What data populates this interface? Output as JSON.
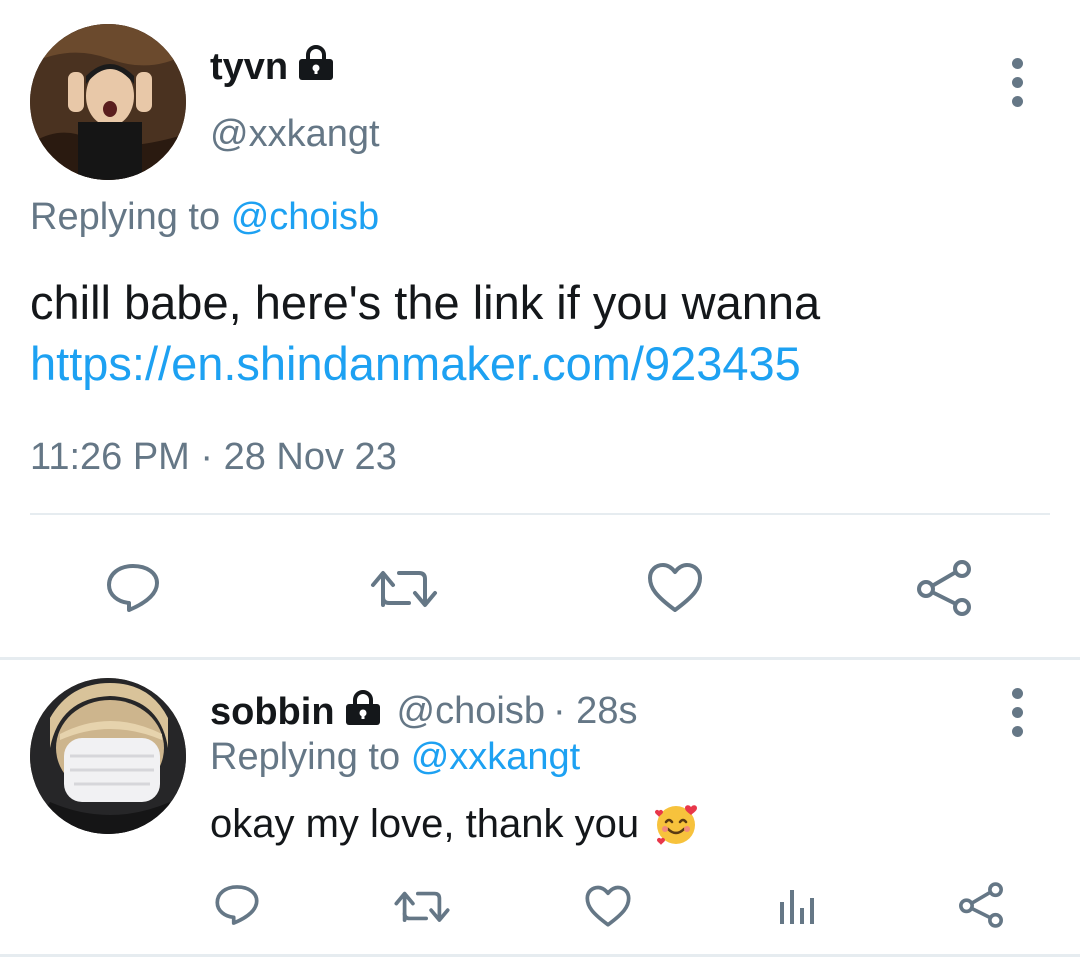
{
  "main_tweet": {
    "display_name": "tyvn",
    "handle": "@xxkangt",
    "replying_prefix": "Replying to",
    "replying_to": "@choisb",
    "text": "chill babe, here's the link if you wanna",
    "link": "https://en.shindanmaker.com/923435",
    "timestamp": "11:26 PM · 28 Nov 23"
  },
  "reply_tweet": {
    "display_name": "sobbin",
    "handle": "@choisb",
    "time": "· 28s",
    "replying_prefix": "Replying to",
    "replying_to": "@xxkangt",
    "text": "okay my love, thank you",
    "emoji": "🥰"
  },
  "icons": {
    "reply": "reply-icon",
    "retweet": "retweet-icon",
    "like": "heart-icon",
    "share": "share-icon",
    "analytics": "analytics-icon",
    "more": "more-vertical-icon",
    "lock": "lock-icon"
  },
  "colors": {
    "link": "#1da1f2",
    "muted": "#657786",
    "text": "#14171a",
    "divider": "#e6ecf0"
  }
}
